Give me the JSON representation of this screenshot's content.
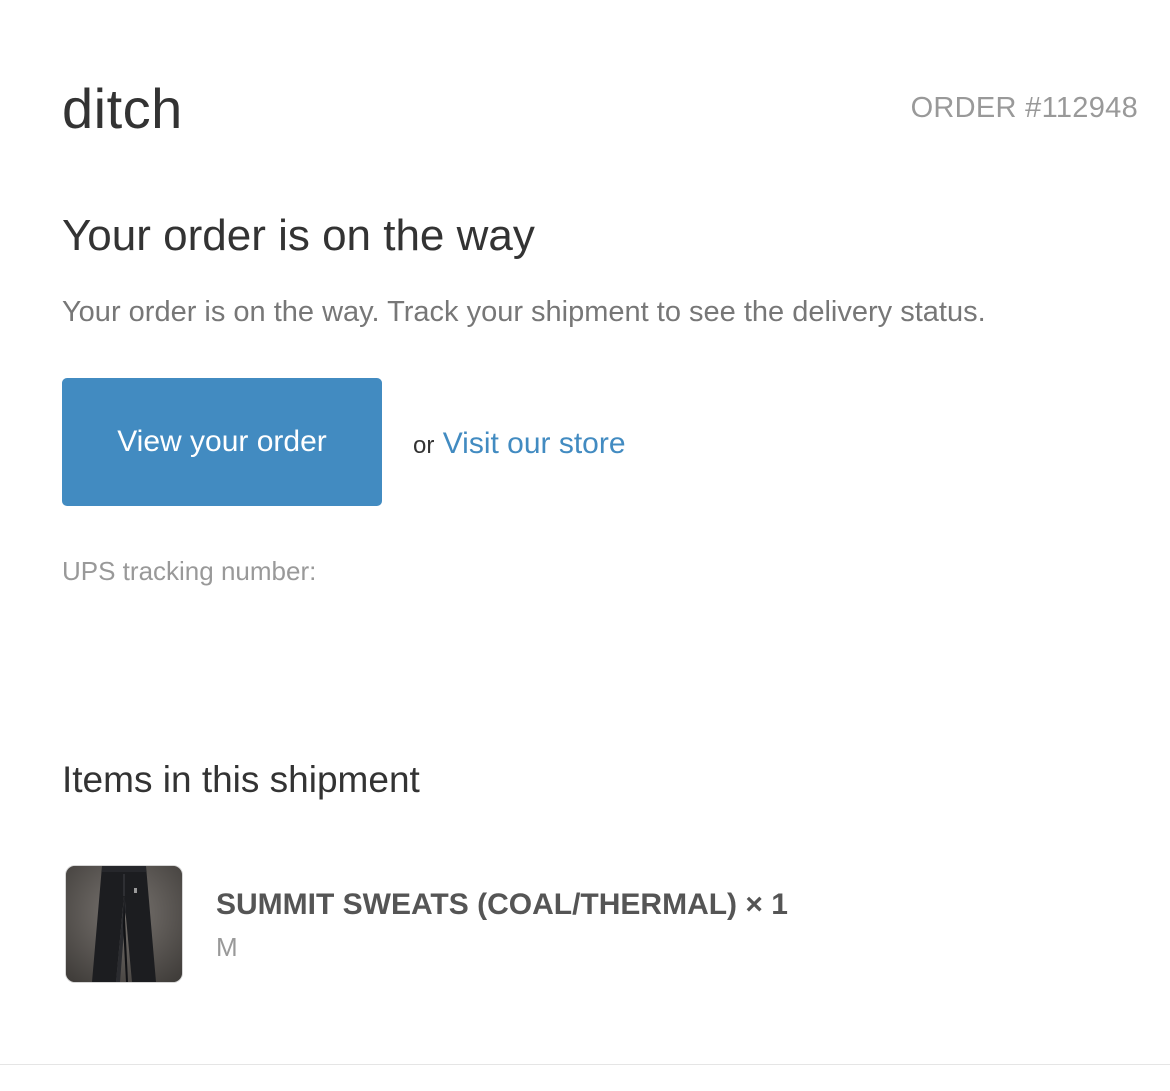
{
  "header": {
    "brand": "ditch",
    "order_number": "ORDER #112948"
  },
  "main": {
    "title": "Your order is on the way",
    "lead": "Your order is on the way. Track your shipment to see the delivery status.",
    "primary_button_label": "View your order",
    "or_text": "or",
    "store_link_label": "Visit our store",
    "tracking_label": "UPS tracking number:"
  },
  "shipment": {
    "section_title": "Items in this shipment",
    "items": [
      {
        "title": "SUMMIT SWEATS (COAL/THERMAL) × 1",
        "variant": "M",
        "thumbnail": "product-thumbnail-image"
      }
    ]
  },
  "colors": {
    "accent": "#428bc1",
    "text": "#333333",
    "muted": "#999999",
    "lead": "#777777"
  }
}
